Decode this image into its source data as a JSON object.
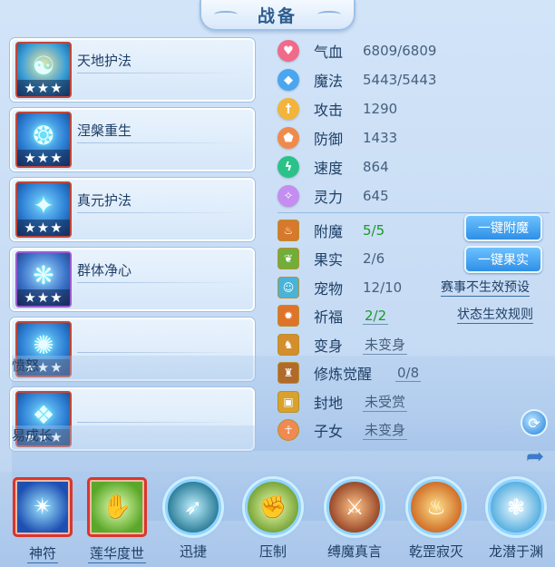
{
  "title": "战备",
  "skills": [
    {
      "name": "天地护法",
      "stars": "★★★",
      "glyph": "☯"
    },
    {
      "name": "涅槃重生",
      "stars": "★★★",
      "glyph": "❂"
    },
    {
      "name": "真元护法",
      "stars": "★★★",
      "glyph": "✦"
    },
    {
      "name": "群体净心",
      "stars": "★★★",
      "glyph": "❋"
    },
    {
      "name": "愤怒",
      "stars": "★★★",
      "glyph": "✺"
    },
    {
      "name": "易成长",
      "stars": "★★★",
      "glyph": "❖"
    }
  ],
  "stats": [
    {
      "label": "气血",
      "value": "6809/6809",
      "icon": "heart-icon",
      "glyph": "♥",
      "color": "#f06a8a"
    },
    {
      "label": "魔法",
      "value": "5443/5443",
      "icon": "diamond-icon",
      "glyph": "◆",
      "color": "#4aa6f0"
    },
    {
      "label": "攻击",
      "value": "1290",
      "icon": "sword-icon",
      "glyph": "†",
      "color": "#f2b43a"
    },
    {
      "label": "防御",
      "value": "1433",
      "icon": "shield-icon",
      "glyph": "⬟",
      "color": "#f08a4b"
    },
    {
      "label": "速度",
      "value": "864",
      "icon": "lightning-icon",
      "glyph": "ϟ",
      "color": "#2bc28a"
    },
    {
      "label": "灵力",
      "value": "645",
      "icon": "spirit-icon",
      "glyph": "✧",
      "color": "#c48ef0"
    }
  ],
  "equip": [
    {
      "label": "附魔",
      "value": "5/5",
      "style": "green",
      "icon": "enchant-icon",
      "glyph": "♨",
      "color": "#d7782c"
    },
    {
      "label": "果实",
      "value": "2/6",
      "style": "plain",
      "icon": "fruit-icon",
      "glyph": "❦",
      "color": "#6fae3a"
    },
    {
      "label": "宠物",
      "value": "12/10",
      "style": "plain",
      "icon": "pet-icon",
      "glyph": "☺",
      "color": "#4ab3d8"
    },
    {
      "label": "祈福",
      "value": "2/2",
      "style": "green-ul",
      "icon": "blessing-icon",
      "glyph": "✹",
      "color": "#e0732a"
    },
    {
      "label": "变身",
      "value": "未变身",
      "style": "ul",
      "icon": "transform-icon",
      "glyph": "♞",
      "color": "#d48e2c"
    },
    {
      "label": "修炼觉醒",
      "value": "0/8",
      "style": "ul",
      "icon": "cultivation-icon",
      "glyph": "♜",
      "color": "#b06a2c"
    },
    {
      "label": "封地",
      "value": "未受赏",
      "style": "ul",
      "icon": "fief-icon",
      "glyph": "▣",
      "color": "#d8a22c"
    },
    {
      "label": "子女",
      "value": "未变身",
      "style": "ul",
      "icon": "children-icon",
      "glyph": "☥",
      "color": "#ee8a52"
    }
  ],
  "buttons": {
    "enchant": "一键附魔",
    "fruit": "一键果实",
    "event_preset": "赛事不生效预设",
    "status_rule": "状态生效规则"
  },
  "bottom_skills": [
    {
      "label": "神符",
      "style": "square",
      "underline": true,
      "glyph": "✴",
      "color": "#1e4fb3"
    },
    {
      "label": "莲华度世",
      "style": "square",
      "underline": true,
      "glyph": "✋",
      "color": "#5aa82a"
    },
    {
      "label": "迅捷",
      "style": "round",
      "underline": false,
      "glyph": "➶",
      "color": "#2f7f9a"
    },
    {
      "label": "压制",
      "style": "round",
      "underline": false,
      "glyph": "✊",
      "color": "#7aa63a"
    },
    {
      "label": "缚魔真言",
      "style": "round",
      "underline": false,
      "glyph": "⚔",
      "color": "#9a4a2a"
    },
    {
      "label": "乾罡寂灭",
      "style": "round",
      "underline": false,
      "glyph": "♨",
      "color": "#d0702a"
    },
    {
      "label": "龙潜于渊",
      "style": "round",
      "underline": false,
      "glyph": "❃",
      "color": "#5ab0e0"
    }
  ]
}
